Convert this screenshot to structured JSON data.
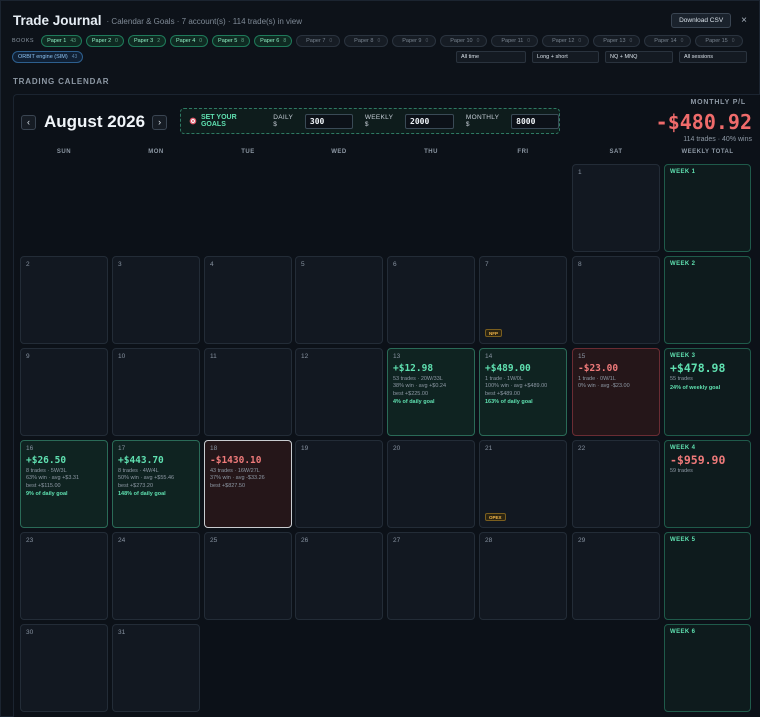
{
  "header": {
    "title": "Trade Journal",
    "subtitle": "· Calendar & Goals · 7 account(s) · 114 trade(s) in view",
    "download_label": "Download CSV",
    "close_label": "×"
  },
  "books": {
    "label": "BOOKS",
    "items": [
      {
        "name": "Paper 1",
        "count": "43",
        "active": true
      },
      {
        "name": "Paper 2",
        "count": "0",
        "active": true
      },
      {
        "name": "Paper 3",
        "count": "2",
        "active": true
      },
      {
        "name": "Paper 4",
        "count": "0",
        "active": true
      },
      {
        "name": "Paper 5",
        "count": "8",
        "active": true
      },
      {
        "name": "Paper 6",
        "count": "8",
        "active": true
      },
      {
        "name": "Paper 7",
        "count": "0",
        "active": false
      },
      {
        "name": "Paper 8",
        "count": "0",
        "active": false
      },
      {
        "name": "Paper 9",
        "count": "0",
        "active": false
      },
      {
        "name": "Paper 10",
        "count": "0",
        "active": false
      },
      {
        "name": "Paper 11",
        "count": "0",
        "active": false
      },
      {
        "name": "Paper 12",
        "count": "0",
        "active": false
      },
      {
        "name": "Paper 13",
        "count": "0",
        "active": false
      },
      {
        "name": "Paper 14",
        "count": "0",
        "active": false
      },
      {
        "name": "Paper 15",
        "count": "0",
        "active": false
      }
    ],
    "engine": {
      "name": "ORBIT engine (SIM)",
      "count": "43"
    }
  },
  "filters": [
    "All time",
    "Long + short",
    "NQ + MNQ",
    "All sessions"
  ],
  "section_label": "TRADING CALENDAR",
  "calendar": {
    "prev_label": "‹",
    "next_label": "›",
    "month_title": "August 2026",
    "goals": {
      "title": "SET YOUR GOALS",
      "daily_label": "DAILY $",
      "daily_value": "300",
      "weekly_label": "WEEKLY $",
      "weekly_value": "2000",
      "monthly_label": "MONTHLY $",
      "monthly_value": "8000"
    },
    "monthly_pl": {
      "label": "MONTHLY P/L",
      "value": "-$480.92",
      "sub": "114 trades · 40% wins"
    },
    "weekdays": [
      "SUN",
      "MON",
      "TUE",
      "WED",
      "THU",
      "FRI",
      "SAT",
      "WEEKLY TOTAL"
    ],
    "weeks": [
      {
        "days": [
          null,
          null,
          null,
          null,
          null,
          null,
          {
            "day": "1"
          }
        ],
        "total": {
          "label": "WEEK 1"
        }
      },
      {
        "days": [
          {
            "day": "2"
          },
          {
            "day": "3"
          },
          {
            "day": "4"
          },
          {
            "day": "5"
          },
          {
            "day": "6"
          },
          {
            "day": "7",
            "badge": "NFP"
          },
          {
            "day": "8"
          }
        ],
        "total": {
          "label": "WEEK 2"
        }
      },
      {
        "days": [
          {
            "day": "9"
          },
          {
            "day": "10"
          },
          {
            "day": "11"
          },
          {
            "day": "12"
          },
          {
            "day": "13",
            "pnl": "+$12.98",
            "state": "pos",
            "lines": [
              "53 trades · 20W/33L",
              "38% win · avg +$0.24",
              "best +$225.00"
            ],
            "goal": "4% of daily goal"
          },
          {
            "day": "14",
            "pnl": "+$489.00",
            "state": "pos",
            "lines": [
              "1 trade · 1W/0L",
              "100% win · avg +$489.00",
              "best +$489.00"
            ],
            "goal": "163% of daily goal"
          },
          {
            "day": "15",
            "pnl": "-$23.00",
            "state": "neg",
            "lines": [
              "1 trade · 0W/1L",
              "0% win · avg -$23.00"
            ]
          }
        ],
        "total": {
          "label": "WEEK 3",
          "pnl": "+$478.98",
          "sign": "p",
          "sub": "55 trades",
          "goal": "24% of weekly goal"
        }
      },
      {
        "days": [
          {
            "day": "16",
            "pnl": "+$26.50",
            "state": "pos",
            "lines": [
              "8 trades · 5W/3L",
              "63% win · avg +$3.31",
              "best +$115.00"
            ],
            "goal": "9% of daily goal"
          },
          {
            "day": "17",
            "pnl": "+$443.70",
            "state": "pos",
            "lines": [
              "8 trades · 4W/4L",
              "50% win · avg +$55.46",
              "best +$273.20"
            ],
            "goal": "148% of daily goal"
          },
          {
            "day": "18",
            "pnl": "-$1430.10",
            "state": "neg",
            "today": true,
            "lines": [
              "43 trades · 16W/27L",
              "37% win · avg -$33.26",
              "best +$827.50"
            ]
          },
          {
            "day": "19"
          },
          {
            "day": "20"
          },
          {
            "day": "21",
            "badge": "OPEX"
          },
          {
            "day": "22"
          }
        ],
        "total": {
          "label": "WEEK 4",
          "pnl": "-$959.90",
          "sign": "n",
          "sub": "59 trades"
        }
      },
      {
        "days": [
          {
            "day": "23"
          },
          {
            "day": "24"
          },
          {
            "day": "25"
          },
          {
            "day": "26"
          },
          {
            "day": "27"
          },
          {
            "day": "28"
          },
          {
            "day": "29"
          }
        ],
        "total": {
          "label": "WEEK 5"
        }
      },
      {
        "days": [
          {
            "day": "30"
          },
          {
            "day": "31"
          },
          null,
          null,
          null,
          null,
          null
        ],
        "total": {
          "label": "WEEK 6"
        }
      }
    ]
  }
}
